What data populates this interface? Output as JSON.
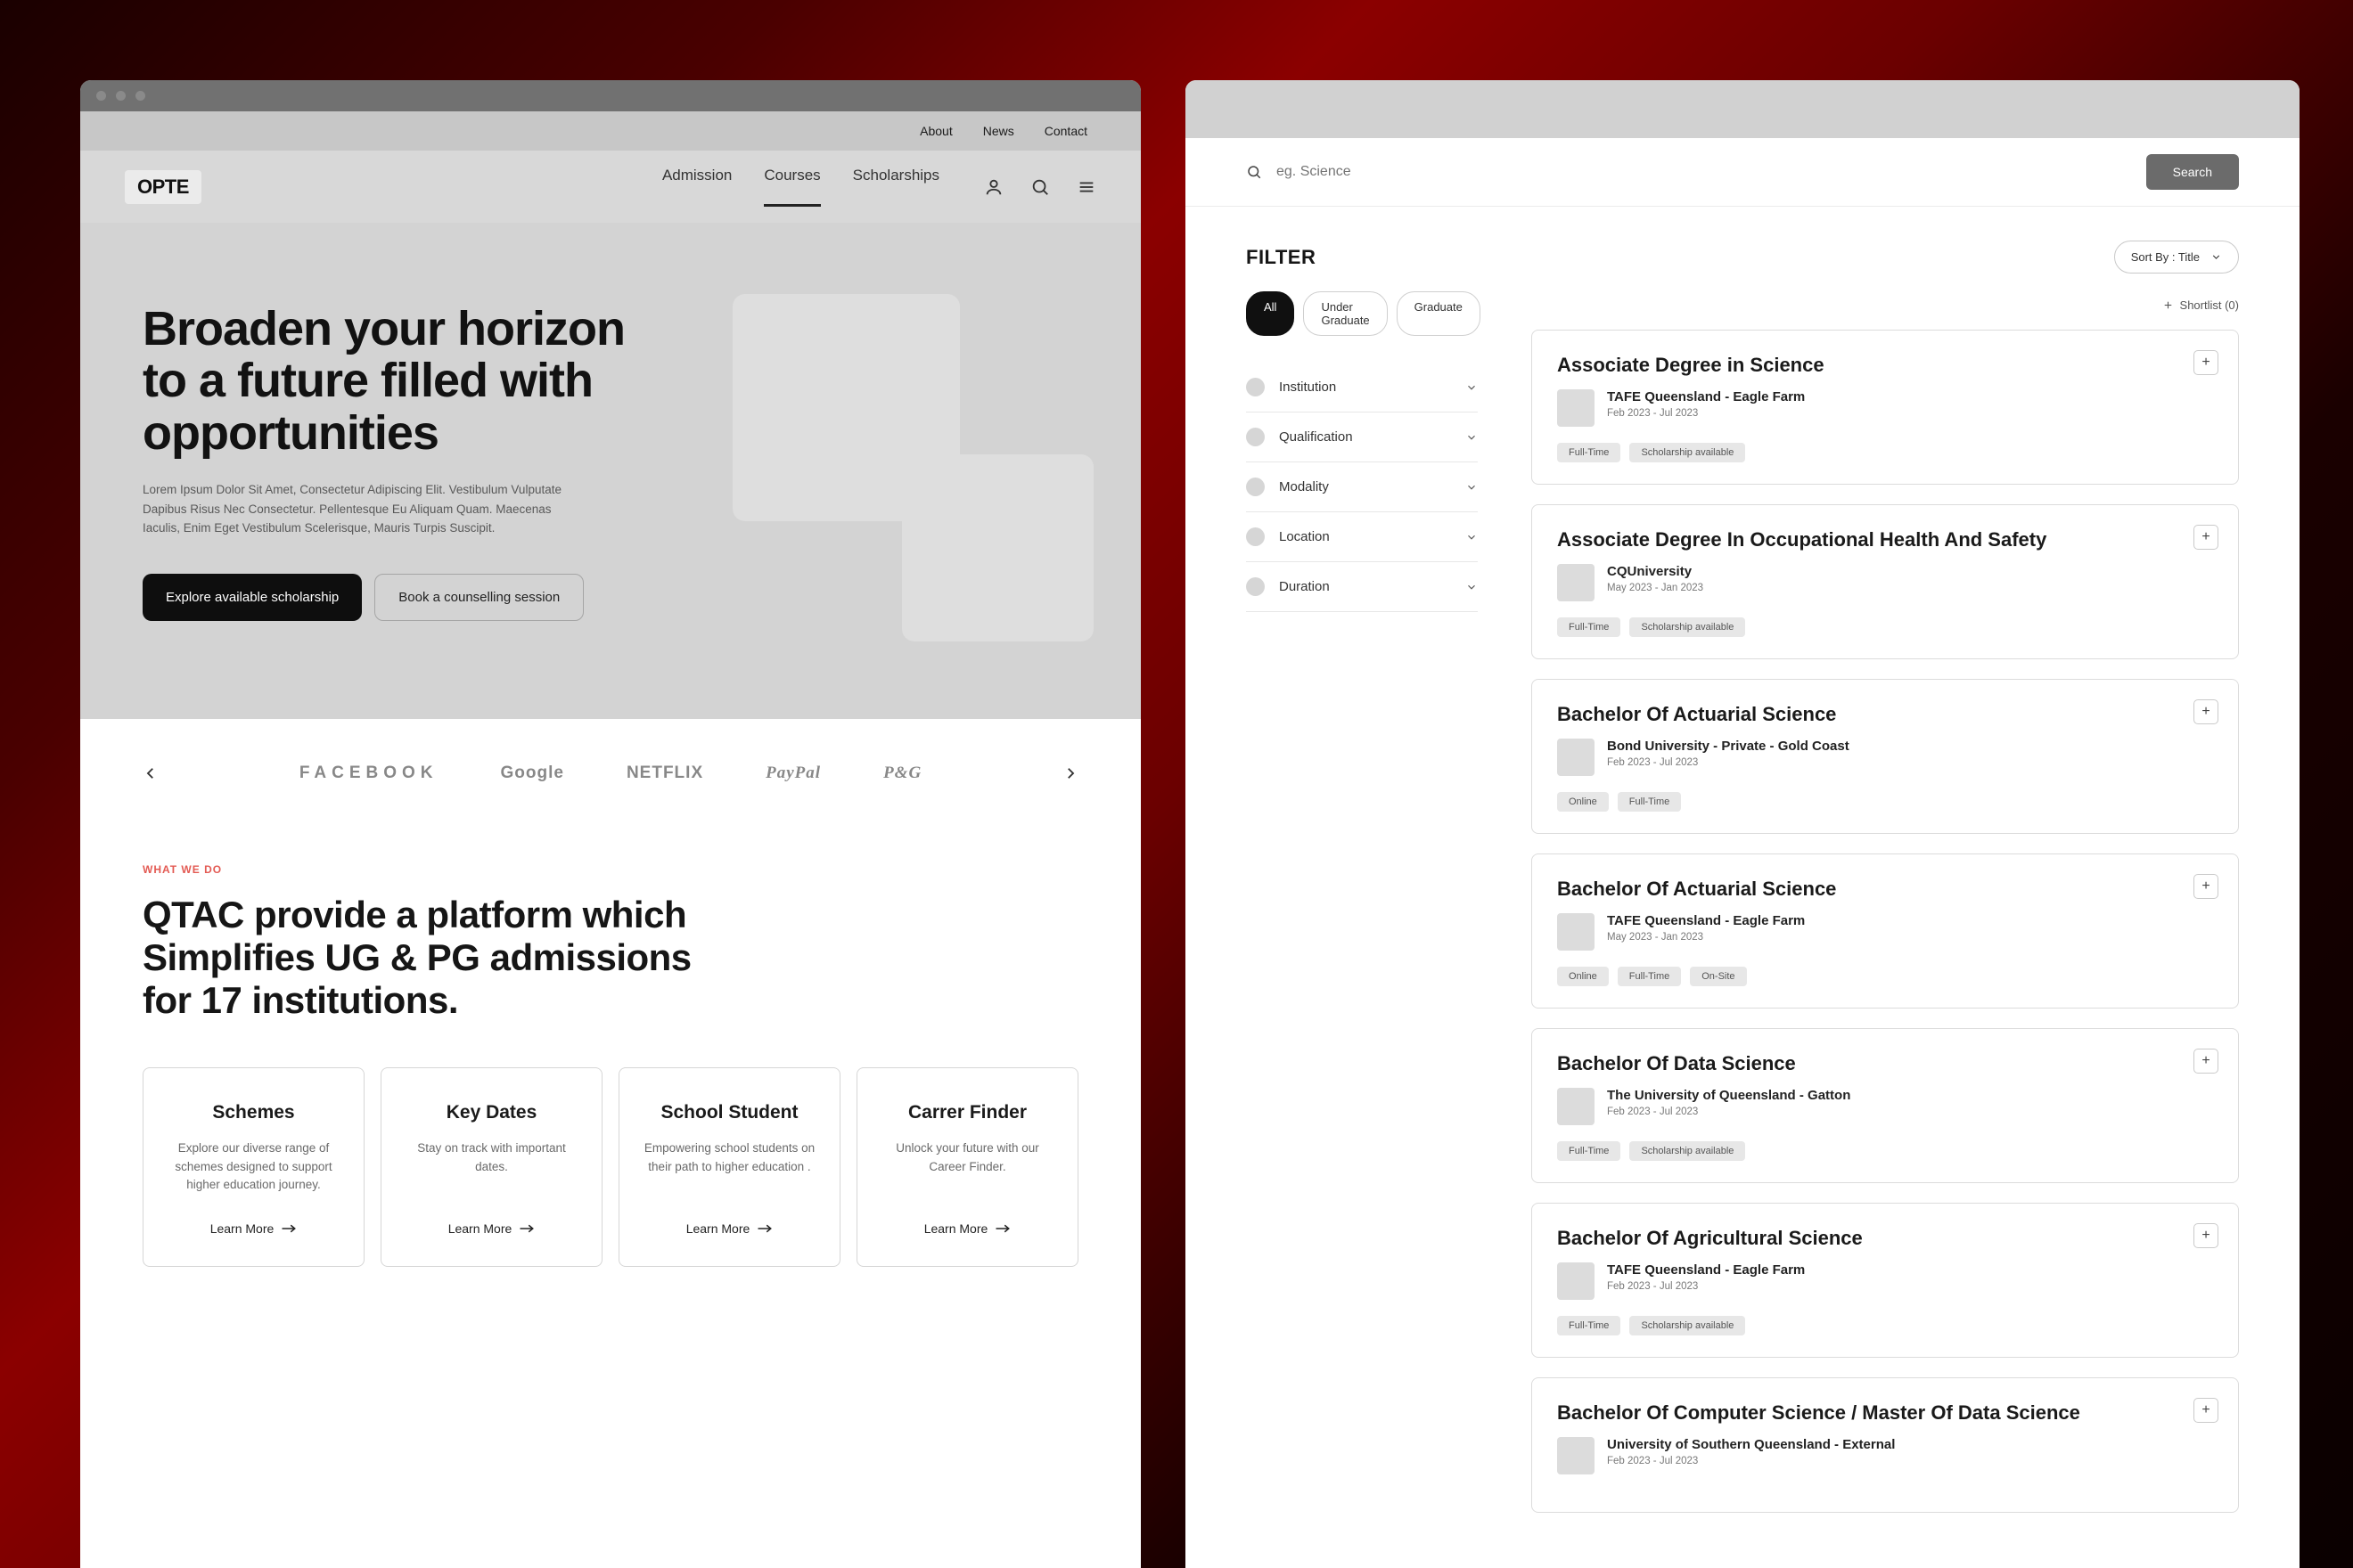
{
  "left": {
    "topbar": {
      "about": "About",
      "news": "News",
      "contact": "Contact"
    },
    "logo": "OPTE",
    "nav": {
      "admission": "Admission",
      "courses": "Courses",
      "scholarships": "Scholarships"
    },
    "hero": {
      "title": "Broaden your horizon to a future filled with opportunities",
      "body": "Lorem Ipsum Dolor Sit Amet, Consectetur Adipiscing Elit. Vestibulum Vulputate Dapibus Risus Nec Consectetur. Pellentesque Eu Aliquam Quam. Maecenas Iaculis, Enim Eget Vestibulum Scelerisque, Mauris Turpis Suscipit.",
      "cta1": "Explore available scholarship",
      "cta2": "Book a counselling session"
    },
    "logos": {
      "a": "FACEBOOK",
      "b": "Google",
      "c": "NETFLIX",
      "d": "PayPal",
      "e": "P&G"
    },
    "wwd": {
      "eyebrow": "WHAT WE DO",
      "title": "QTAC provide a platform which Simplifies UG & PG admissions for 17 institutions.",
      "learn_more": "Learn More",
      "cards": [
        {
          "title": "Schemes",
          "body": "Explore our diverse range of schemes designed to support higher education journey."
        },
        {
          "title": "Key Dates",
          "body": "Stay on track with important dates."
        },
        {
          "title": "School Student",
          "body": "Empowering school students on their path to higher education ."
        },
        {
          "title": "Carrer Finder",
          "body": "Unlock your future with our Career Finder."
        }
      ]
    }
  },
  "right": {
    "search_placeholder": "eg. Science",
    "search_btn": "Search",
    "filter_title": "FILTER",
    "sortby": "Sort By : Title",
    "chips": {
      "all": "All",
      "ug": "Under Graduate",
      "grad": "Graduate"
    },
    "shortlist": "Shortlist (0)",
    "facets": [
      {
        "label": "Institution"
      },
      {
        "label": "Qualification"
      },
      {
        "label": "Modality"
      },
      {
        "label": "Location"
      },
      {
        "label": "Duration"
      }
    ],
    "courses": [
      {
        "title": "Associate Degree in Science",
        "inst": "TAFE Queensland - Eagle Farm",
        "dates": "Feb 2023 - Jul 2023",
        "tags": [
          "Full-Time",
          "Scholarship available"
        ]
      },
      {
        "title": "Associate Degree In Occupational Health And Safety",
        "inst": "CQUniversity",
        "dates": "May 2023 - Jan 2023",
        "tags": [
          "Full-Time",
          "Scholarship available"
        ]
      },
      {
        "title": "Bachelor Of Actuarial Science",
        "inst": "Bond University - Private - Gold Coast",
        "dates": "Feb 2023 - Jul 2023",
        "tags": [
          "Online",
          "Full-Time"
        ]
      },
      {
        "title": "Bachelor Of Actuarial Science",
        "inst": "TAFE Queensland - Eagle Farm",
        "dates": "May 2023 - Jan 2023",
        "tags": [
          "Online",
          "Full-Time",
          "On-Site"
        ]
      },
      {
        "title": "Bachelor Of Data Science",
        "inst": "The University of Queensland - Gatton",
        "dates": "Feb 2023 - Jul 2023",
        "tags": [
          "Full-Time",
          "Scholarship available"
        ]
      },
      {
        "title": "Bachelor Of Agricultural Science",
        "inst": "TAFE Queensland - Eagle Farm",
        "dates": "Feb 2023 - Jul 2023",
        "tags": [
          "Full-Time",
          "Scholarship available"
        ]
      },
      {
        "title": "Bachelor Of Computer Science / Master Of Data Science",
        "inst": "University of Southern Queensland - External",
        "dates": "Feb 2023 - Jul 2023",
        "tags": []
      }
    ]
  }
}
